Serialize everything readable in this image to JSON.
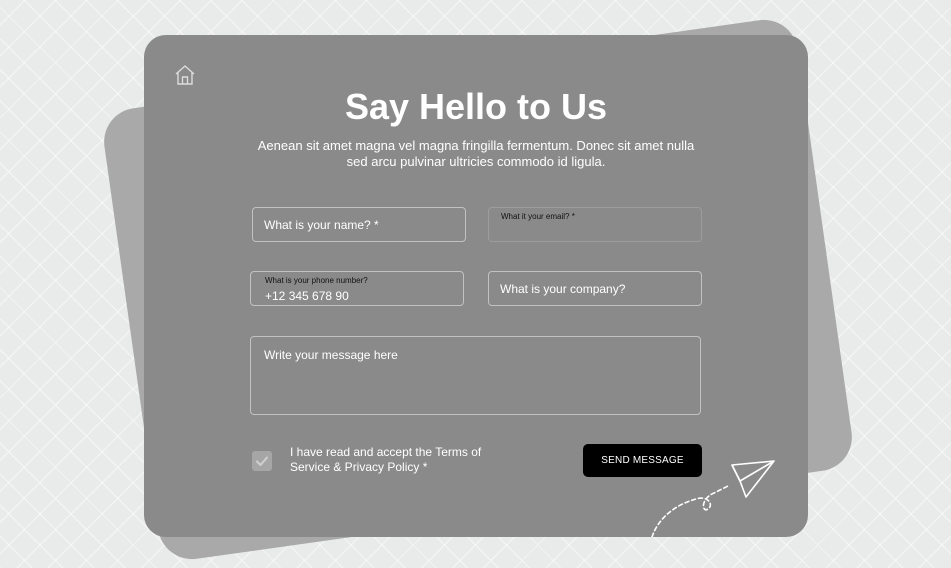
{
  "header": {
    "title": "Say Hello to Us",
    "subtitle": "Aenean sit amet magna vel magna fringilla fermentum. Donec sit amet nulla sed arcu pulvinar ultricies commodo id ligula."
  },
  "form": {
    "name": {
      "placeholder": "What is your name? *",
      "value": ""
    },
    "email": {
      "label": "What it your email? *",
      "value": ""
    },
    "phone": {
      "label": "What is your phone number?",
      "value": "+12 345 678 90"
    },
    "company": {
      "placeholder": "What is your company?",
      "value": ""
    },
    "message": {
      "placeholder": "Write your message here",
      "value": ""
    },
    "consent": {
      "label": "I have read and accept the Terms of Service & Privacy Policy *",
      "checked": true
    },
    "submit_label": "SEND MESSAGE"
  },
  "icons": {
    "home": "home-icon",
    "check": "check-icon",
    "plane": "paper-plane-icon"
  },
  "colors": {
    "page_background": "#e9ebea",
    "card": "#8a8a8a",
    "back_card": "#a9a9a9",
    "button": "#000000",
    "text": "#ffffff"
  }
}
